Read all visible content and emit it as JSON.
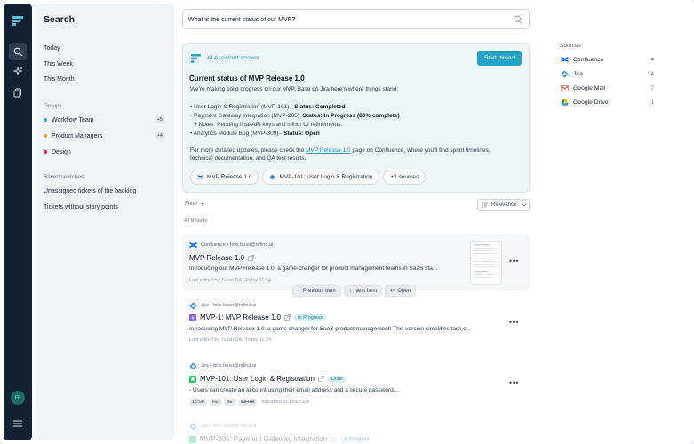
{
  "sidebar": {
    "title": "Search",
    "time_filters": [
      "Today",
      "This Week",
      "This Month"
    ],
    "groups_heading": "Groups",
    "groups": [
      {
        "label": "Workflow Team",
        "count": "+5",
        "color": "#22a7c9"
      },
      {
        "label": "Product Managers",
        "count": "+4",
        "color": "#f59e0b"
      },
      {
        "label": "Design",
        "count": "",
        "color": "#e11d48"
      }
    ],
    "saved_heading": "Saved searches",
    "saved": [
      "Unassigned tickets of the backlog",
      "Tickets without story points"
    ],
    "avatar": "FF"
  },
  "search": {
    "query": "What is the current status of our MVP?"
  },
  "ai_answer": {
    "label": "AI Assistant answer",
    "start_thread": "Start thread",
    "title": "Current status of MVP Release 1.0",
    "intro": "We're making solid progress on our MVP. Base on Jira here's where things stand:",
    "items": [
      {
        "text": "• User Login & Registration (MVP-101) - ",
        "status": "Status: Completed"
      },
      {
        "text": "• Payment Gateway Integration (MVP-205): ",
        "status": "Status: In Progress (80% complete)"
      },
      {
        "text": "   • Notes: Pending final API keys and minor UI refinements.",
        "status": ""
      },
      {
        "text": "• Analytics Module Bug (MVP-309) - ",
        "status": "Status: Open"
      }
    ],
    "footer_pre": "For more detailed updates, please check the ",
    "footer_link": "MVP Release 1.0",
    "footer_post": " page on Confluence, where you'll find sprint timelines,",
    "footer_line2": "technical documentation, and QA test results.",
    "chips": [
      "MVP Release 1.0",
      "MVP-101: User Login & Registration",
      "+2 sources"
    ]
  },
  "filter": {
    "label": "Filter",
    "sort": "Relevance",
    "results": "40 Results"
  },
  "results": [
    {
      "source": "Confluence • felix.faust@refind.ai",
      "title": "MVP Release 1.0",
      "desc": "Introducing our MVP Release 1.0: a game-changer for product management teams in SaaS sta...",
      "meta": "Last edited by Julian Dik, Today 11:24"
    },
    {
      "source": "Jira • felix.faust@refind.ai",
      "title": "MVP-1: MVP Release 1.0",
      "badge": "In Progress",
      "desc": "Introducing MVP Release 1.0: a game-changer for SaaS product management! This version simplifies task c...",
      "meta": "Last edited by Julian Dik, Today 11:24"
    },
    {
      "source": "Jira • felix.faust@refind.ai",
      "title": "MVP-101: User Login & Registration",
      "badge": "Done",
      "desc": "- Users can create an account using their email address and a secure password....",
      "tags": [
        "13 SP",
        "FE",
        "BE",
        "INFRA"
      ],
      "assigned": "Assigned to Julian Dik"
    },
    {
      "source": "Jira • felix.faust@refind.ai",
      "title": "MVP-205: Payment Gateway Integration",
      "badge": "In Progress"
    }
  ],
  "result_nav": [
    "Previous Item",
    "Next Item",
    "Open"
  ],
  "sources": {
    "heading": "Sources",
    "items": [
      {
        "name": "Confluence",
        "count": "4"
      },
      {
        "name": "Jira",
        "count": "24"
      },
      {
        "name": "Google Mail",
        "count": "7"
      },
      {
        "name": "Google Drive",
        "count": "1"
      }
    ]
  }
}
